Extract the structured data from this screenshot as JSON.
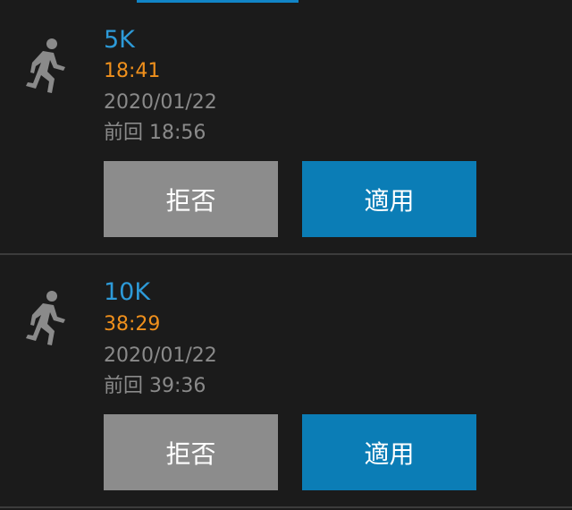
{
  "records": [
    {
      "distance": "5K",
      "time": "18:41",
      "date": "2020/01/22",
      "previous_label": "前回",
      "previous_time": "18:56",
      "reject_label": "拒否",
      "apply_label": "適用"
    },
    {
      "distance": "10K",
      "time": "38:29",
      "date": "2020/01/22",
      "previous_label": "前回",
      "previous_time": "39:36",
      "reject_label": "拒否",
      "apply_label": "適用"
    }
  ],
  "icons": {
    "activity": "running-person-icon"
  },
  "colors": {
    "background": "#1b1b1b",
    "distance": "#2d9ad8",
    "time": "#f0901c",
    "secondary_text": "#8a8a8a",
    "reject_button": "#8c8c8c",
    "apply_button": "#0b7db6",
    "tab_indicator": "#1185c7"
  }
}
